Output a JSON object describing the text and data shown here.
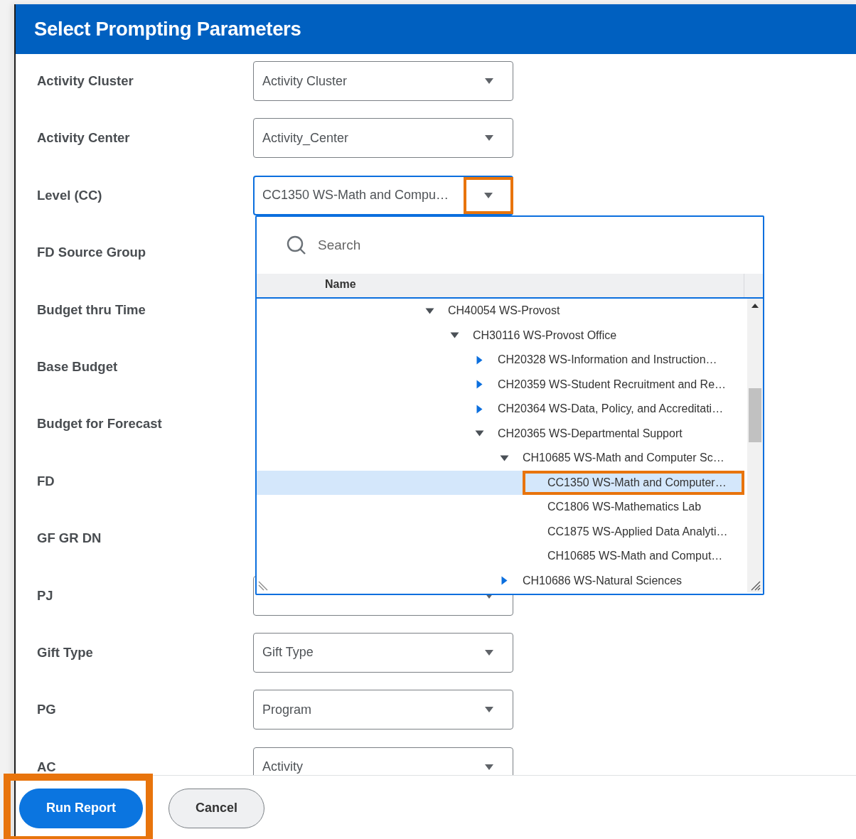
{
  "dialog": {
    "title": "Select Prompting Parameters"
  },
  "rows": [
    {
      "label": "Activity Cluster",
      "field": {
        "value": "Activity Cluster",
        "focused": false
      }
    },
    {
      "label": "Activity Center",
      "field": {
        "value": "Activity_Center",
        "focused": false
      }
    },
    {
      "label": "Level (CC)",
      "field": {
        "value": "CC1350 WS-Math and Compu…",
        "focused": true,
        "annotated": true,
        "dropdown": {
          "search": {
            "placeholder": "Search"
          },
          "column": "Name",
          "tree": [
            {
              "text": "CH40054 WS-Provost",
              "expanded": true,
              "selected": false,
              "children": [
                {
                  "text": "CH30116 WS-Provost Office",
                  "expanded": true,
                  "selected": false,
                  "children": [
                    {
                      "text": "CH20328 WS-Information and Instruction…",
                      "expanded": false,
                      "selected": false
                    },
                    {
                      "text": "CH20359 WS-Student Recruitment and Re…",
                      "expanded": false,
                      "selected": false
                    },
                    {
                      "text": "CH20364 WS-Data, Policy, and Accreditati…",
                      "expanded": false,
                      "selected": false
                    },
                    {
                      "text": "CH20365 WS-Departmental Support",
                      "expanded": true,
                      "selected": false,
                      "children": [
                        {
                          "text": "CH10685 WS-Math and Computer Sc…",
                          "expanded": true,
                          "selected": false,
                          "children": [
                            {
                              "text": "CC1350 WS-Math and Computer…",
                              "selected": true,
                              "annotated": true
                            },
                            {
                              "text": "CC1806 WS-Mathematics Lab",
                              "selected": false
                            },
                            {
                              "text": "CC1875 WS-Applied Data Analyti…",
                              "selected": false
                            },
                            {
                              "text": "CH10685 WS-Math and Comput…",
                              "selected": false
                            }
                          ]
                        },
                        {
                          "text": "CH10686 WS-Natural Sciences",
                          "expanded": false,
                          "selected": false
                        }
                      ]
                    }
                  ]
                }
              ]
            }
          ]
        }
      }
    },
    {
      "label": "FD Source Group"
    },
    {
      "label": "Budget thru Time"
    },
    {
      "label": "Base Budget"
    },
    {
      "label": "Budget for Forecast"
    },
    {
      "label": "FD"
    },
    {
      "label": "GF GR DN"
    },
    {
      "label": "PJ",
      "field": {
        "focused": false
      }
    },
    {
      "label": "Gift Type",
      "field": {
        "value": "Gift Type",
        "focused": false
      }
    },
    {
      "label": "PG",
      "field": {
        "value": "Program",
        "focused": false
      }
    },
    {
      "label": "AC",
      "field": {
        "value": "Activity",
        "focused": false
      }
    }
  ],
  "buttons": [
    {
      "label": "Run Report",
      "kind": "primary",
      "annotated": true
    },
    {
      "label": "Cancel",
      "kind": "secondary",
      "annotated": false
    }
  ]
}
